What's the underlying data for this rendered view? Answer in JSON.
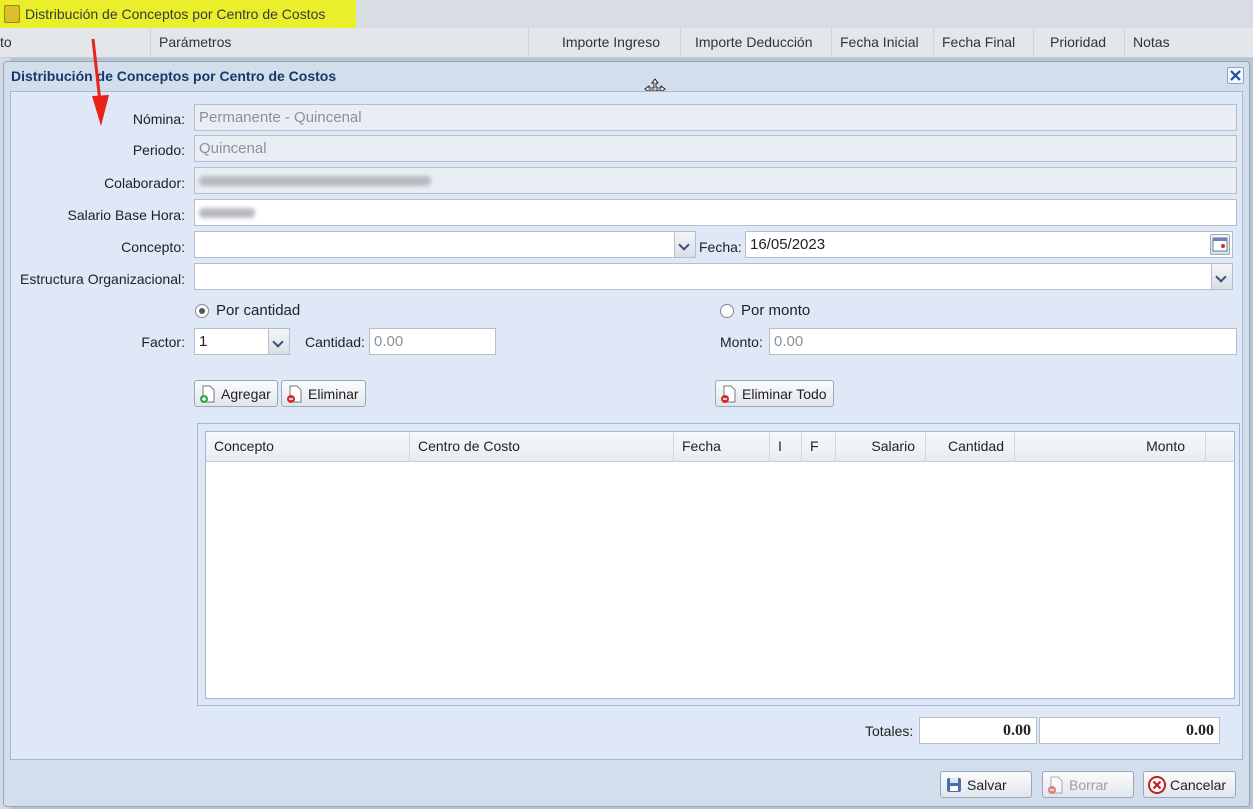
{
  "background": {
    "tab_title": "Distribución de Conceptos por Centro de Costos",
    "columns": [
      "to",
      "Parámetros",
      "Importe Ingreso",
      "Importe Deducción",
      "Fecha Inicial",
      "Fecha Final",
      "Prioridad",
      "Notas"
    ]
  },
  "dialog": {
    "title": "Distribución de Conceptos por Centro de Costos",
    "fields": {
      "nomina_label": "Nómina:",
      "nomina_value": "Permanente - Quincenal",
      "periodo_label": "Periodo:",
      "periodo_value": "Quincenal",
      "colaborador_label": "Colaborador:",
      "salario_label": "Salario Base Hora:",
      "concepto_label": "Concepto:",
      "concepto_value": "",
      "fecha_label": "Fecha:",
      "fecha_value": "16/05/2023",
      "estructura_label": "Estructura Organizacional:",
      "estructura_value": ""
    },
    "radios": {
      "por_cantidad": "Por cantidad",
      "por_monto": "Por monto",
      "selected": "por_cantidad"
    },
    "factor_label": "Factor:",
    "factor_value": "1",
    "cantidad_label": "Cantidad:",
    "cantidad_placeholder": "0.00",
    "monto_label": "Monto:",
    "monto_placeholder": "0.00",
    "buttons": {
      "agregar": "Agregar",
      "eliminar": "Eliminar",
      "eliminar_todo": "Eliminar Todo",
      "salvar": "Salvar",
      "borrar": "Borrar",
      "cancelar": "Cancelar"
    },
    "grid_columns": [
      "Concepto",
      "Centro de Costo",
      "Fecha",
      "I",
      "F",
      "Salario",
      "Cantidad",
      "Monto"
    ],
    "totals_label": "Totales:",
    "totals_cantidad": "0.00",
    "totals_monto": "0.00"
  },
  "colors": {
    "title_text": "#17386b",
    "dialog_bg": "#dfe8f6",
    "annotation_arrow": "#e8231a",
    "tab_highlight": "#e9ef2a"
  }
}
